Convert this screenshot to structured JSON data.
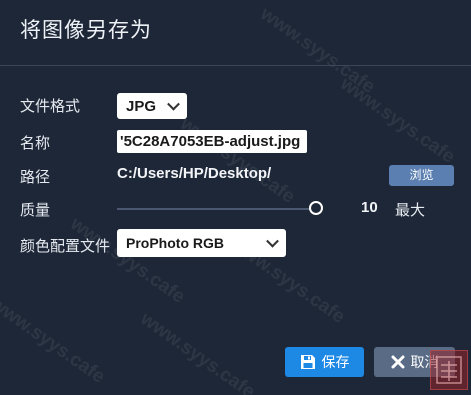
{
  "dialog": {
    "title": "将图像另存为"
  },
  "form": {
    "format_label": "文件格式",
    "format_value": "JPG",
    "name_label": "名称",
    "name_value": "'5C28A7053EB-adjust.jpg",
    "path_label": "路径",
    "path_value": "C:/Users/HP/Desktop/",
    "browse_label": "浏览",
    "quality_label": "质量",
    "quality_value": "10",
    "quality_max_label": "最大",
    "quality_level": 1.0,
    "profile_label": "颜色配置文件",
    "profile_value": "ProPhoto RGB"
  },
  "actions": {
    "save_label": "保存",
    "cancel_label": "取消"
  },
  "watermark": {
    "text": "www.syys.cafe"
  },
  "colors": {
    "background": "#1e2737",
    "primary_button": "#1e88e5",
    "secondary_button": "#5a6b86",
    "browse_button": "#5b7fb0"
  },
  "icons": {
    "save": "floppy-disk-icon",
    "cancel": "close-x-icon",
    "select": "chevron-down-icon"
  }
}
